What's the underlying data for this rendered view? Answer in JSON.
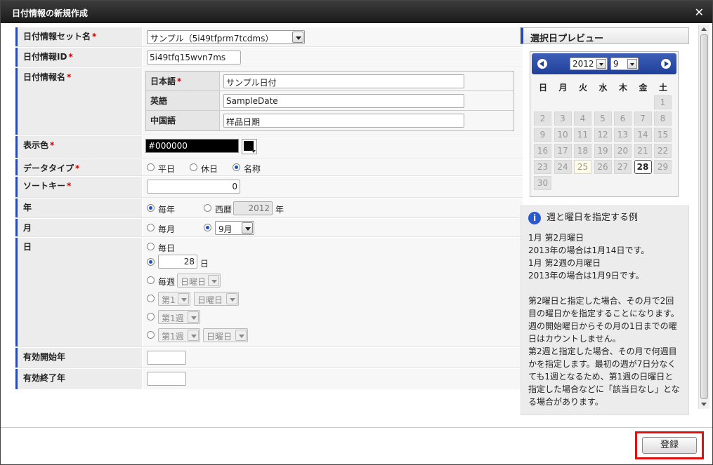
{
  "dialog": {
    "title": "日付情報の新規作成"
  },
  "form": {
    "setname": {
      "label": "日付情報セット名",
      "req": "*",
      "value": "サンプル（5i49tfprm7tcdms）"
    },
    "id": {
      "label": "日付情報ID",
      "req": "*",
      "value": "5i49tfq15wvn7ms"
    },
    "name": {
      "label": "日付情報名",
      "req": "*",
      "langs": [
        {
          "label": "日本語",
          "req": "*",
          "value": "サンプル日付"
        },
        {
          "label": "英語",
          "value": "SampleDate"
        },
        {
          "label": "中国語",
          "value": "样品日期"
        }
      ]
    },
    "color": {
      "label": "表示色",
      "req": "*",
      "value": "#000000",
      "swatch": "#000000"
    },
    "datatype": {
      "label": "データタイプ",
      "req": "*",
      "options": [
        "平日",
        "休日",
        "名称"
      ],
      "selected": "名称"
    },
    "sortkey": {
      "label": "ソートキー",
      "req": "*",
      "value": "0"
    },
    "year": {
      "label": "年",
      "opt_every": "毎年",
      "opt_seireki": "西暦",
      "year_value": "2012",
      "unit": "年",
      "selected": "毎年"
    },
    "month": {
      "label": "月",
      "opt_every": "毎月",
      "month_value": "9月",
      "selected": "month"
    },
    "day": {
      "label": "日",
      "opt_every": "毎日",
      "day_value": "28",
      "day_unit": "日",
      "opt_weekly": "毎週",
      "weekday": "日曜日",
      "nth": "第1",
      "nth_week": "第1週",
      "selected": "day"
    },
    "valid_start": {
      "label": "有効開始年",
      "value": ""
    },
    "valid_end": {
      "label": "有効終了年",
      "value": ""
    }
  },
  "preview": {
    "title": "選択日プレビュー",
    "year": "2012",
    "month": "9",
    "dow": [
      "日",
      "月",
      "火",
      "水",
      "木",
      "金",
      "土"
    ],
    "weeks": [
      [
        "",
        "",
        "",
        "",
        "",
        "",
        "1"
      ],
      [
        "2",
        "3",
        "4",
        "5",
        "6",
        "7",
        "8"
      ],
      [
        "9",
        "10",
        "11",
        "12",
        "13",
        "14",
        "15"
      ],
      [
        "16",
        "17",
        "18",
        "19",
        "20",
        "21",
        "22"
      ],
      [
        "23",
        "24",
        "25",
        "26",
        "27",
        "28",
        "29"
      ],
      [
        "30",
        "",
        "",
        "",
        "",
        "",
        ""
      ]
    ],
    "selected_day": "28",
    "highlight_day": "25"
  },
  "info": {
    "icon": "i",
    "title": "週と曜日を指定する例",
    "body": "1月 第2月曜日\n2013年の場合は1月14日です。\n1月 第2週の月曜日\n2013年の場合は1月9日です。\n\n第2曜日と指定した場合、その月で2回目の曜日かを指定することになります。週の開始曜日からその月の1日までの曜日はカウントしません。\n第2週と指定した場合、その月で何週目かを指定します。最初の週が7日分なくても1週となるため、第1週の日曜日と指定した場合などに「該当日なし」となる場合があります。"
  },
  "footer": {
    "submit": "登録"
  },
  "colors": {
    "accent": "#2a4aa8",
    "highlight": "#e01010"
  }
}
